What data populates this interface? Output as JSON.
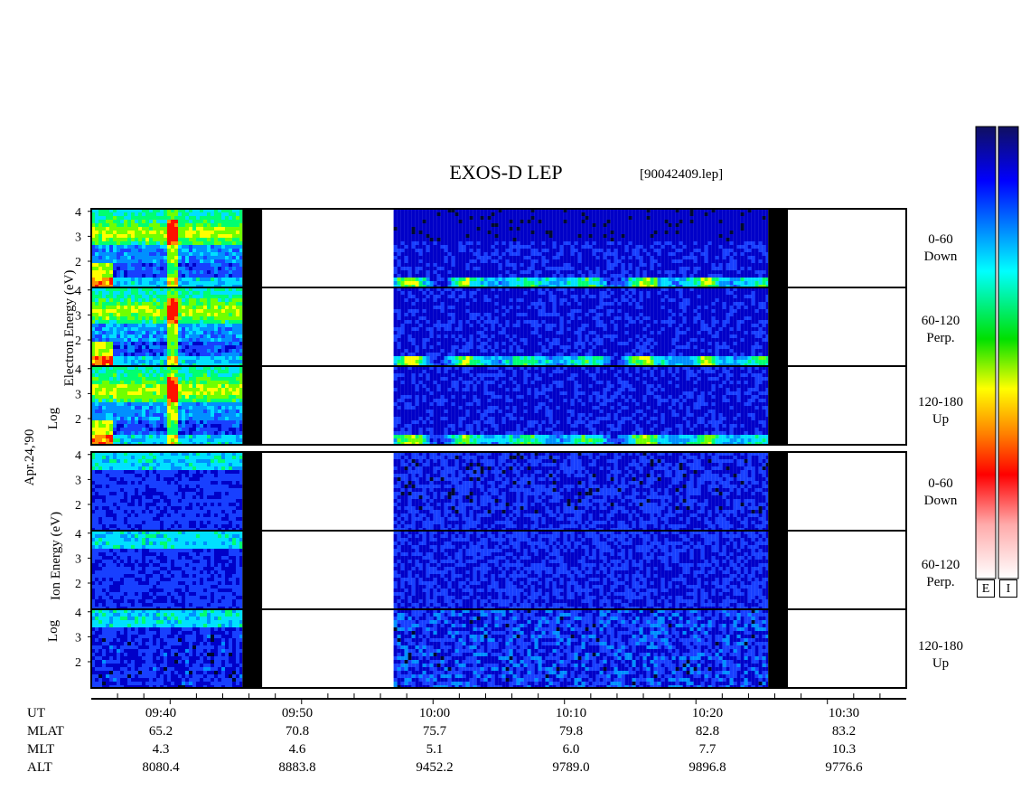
{
  "header": {
    "title": "EXOS-D LEP",
    "file": "[90042409.lep]"
  },
  "date_label": "Apr.24,'90",
  "electron": {
    "ylabel_main": "Electron Energy (eV)",
    "ylabel_log": "Log",
    "panels": [
      {
        "angle": "0-60",
        "direction": "Down"
      },
      {
        "angle": "60-120",
        "direction": "Perp."
      },
      {
        "angle": "120-180",
        "direction": "Up"
      }
    ]
  },
  "ion": {
    "ylabel_main": "Ion Energy (eV)",
    "ylabel_log": "Log",
    "panels": [
      {
        "angle": "0-60",
        "direction": "Down"
      },
      {
        "angle": "60-120",
        "direction": "Perp."
      },
      {
        "angle": "120-180",
        "direction": "Up"
      }
    ]
  },
  "colorbars": [
    {
      "label": "E"
    },
    {
      "label": "I"
    }
  ],
  "ephemeris": {
    "rows": [
      "UT",
      "MLAT",
      "MLT",
      "ALT"
    ],
    "columns": [
      {
        "UT": "09:40",
        "MLAT": "65.2",
        "MLT": "4.3",
        "ALT": "8080.4"
      },
      {
        "UT": "09:50",
        "MLAT": "70.8",
        "MLT": "4.6",
        "ALT": "8883.8"
      },
      {
        "UT": "10:00",
        "MLAT": "75.7",
        "MLT": "5.1",
        "ALT": "9452.2"
      },
      {
        "UT": "10:10",
        "MLAT": "79.8",
        "MLT": "6.0",
        "ALT": "9789.0"
      },
      {
        "UT": "10:20",
        "MLAT": "82.8",
        "MLT": "7.7",
        "ALT": "9896.8"
      },
      {
        "UT": "10:30",
        "MLAT": "83.2",
        "MLT": "10.3",
        "ALT": "9776.6"
      }
    ]
  },
  "chart_data": {
    "type": "heatmap",
    "title": "EXOS-D LEP",
    "subtitle": "[90042409.lep]",
    "x_axis": {
      "quantity": "UT",
      "range": [
        "09:34",
        "10:36"
      ],
      "major_ticks": [
        "09:40",
        "09:50",
        "10:00",
        "10:10",
        "10:20",
        "10:30"
      ],
      "minor_tick_minutes": 2
    },
    "y_axis": {
      "quantity": "Log Energy (eV)",
      "range": [
        0.95,
        4.1
      ],
      "ticks": [
        2,
        3,
        4
      ]
    },
    "data_gaps": [
      {
        "kind": "black",
        "from": "09:45.5",
        "to": "09:47.0"
      },
      {
        "kind": "no data",
        "from": "09:47.0",
        "to": "09:57.0"
      },
      {
        "kind": "black",
        "from": "10:25.5",
        "to": "10:27.0"
      }
    ],
    "panels": [
      {
        "species": "electron",
        "pitch_angle": "0-60",
        "direction": "Down"
      },
      {
        "species": "electron",
        "pitch_angle": "60-120",
        "direction": "Perp."
      },
      {
        "species": "electron",
        "pitch_angle": "120-180",
        "direction": "Up"
      },
      {
        "species": "ion",
        "pitch_angle": "0-60",
        "direction": "Down"
      },
      {
        "species": "ion",
        "pitch_angle": "60-120",
        "direction": "Perp."
      },
      {
        "species": "ion",
        "pitch_angle": "120-180",
        "direction": "Up"
      }
    ],
    "colorscale": [
      "#ffffff",
      "#ff0000",
      "#ff8800",
      "#ffff00",
      "#00ff00",
      "#00ffff",
      "#0066ff",
      "#000088"
    ],
    "grid": false,
    "legend": "right (vertical color bars E and I)"
  }
}
